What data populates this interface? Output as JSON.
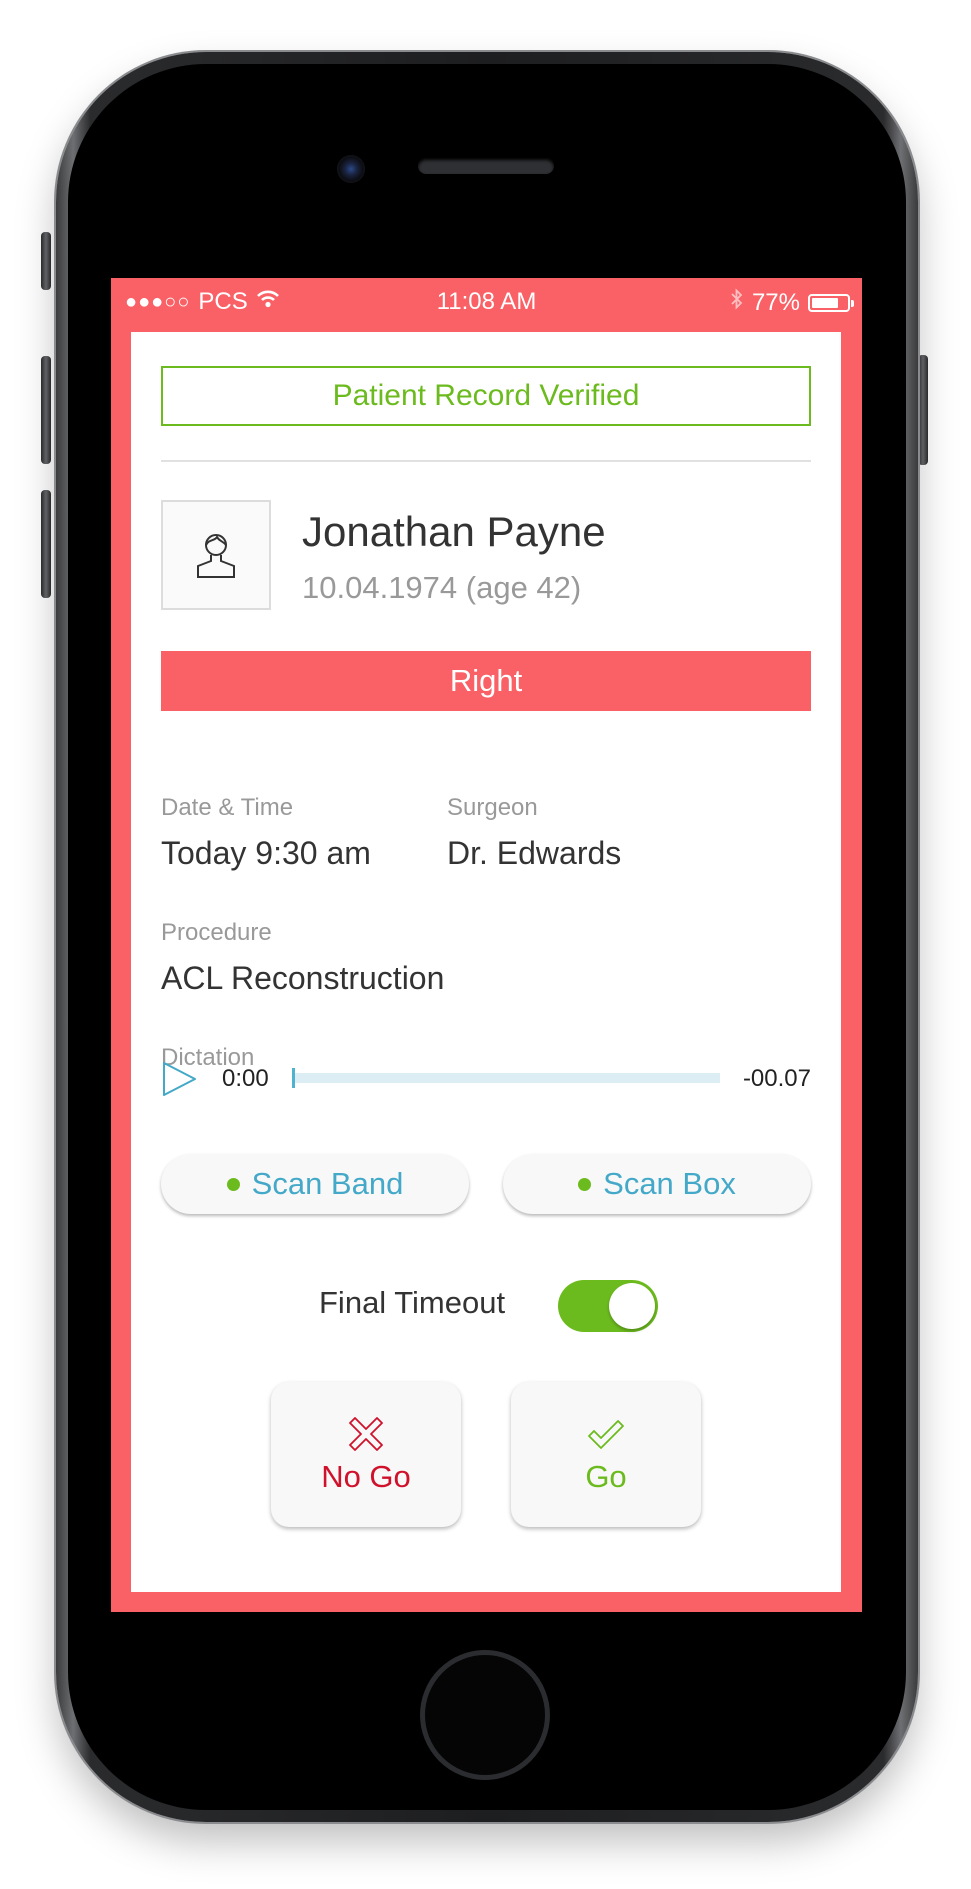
{
  "status_bar": {
    "signal": "●●●○○",
    "carrier": "PCS",
    "time": "11:08 AM",
    "battery": "77%",
    "battery_level": 0.77
  },
  "verification": {
    "label": "Patient Record Verified"
  },
  "patient": {
    "name": "Jonathan Payne",
    "dob": "10.04.1974 (age 42)"
  },
  "side_banner": {
    "label": "Right"
  },
  "details": {
    "date_label": "Date & Time",
    "date_value": "Today 9:30 am",
    "surgeon_label": "Surgeon",
    "surgeon_value": "Dr. Edwards",
    "procedure_label": "Procedure",
    "procedure_value": "ACL Reconstruction"
  },
  "dictation": {
    "label": "Dictation",
    "elapsed": "0:00",
    "remaining": "-00.07",
    "progress": 0
  },
  "scan_buttons": {
    "band": "Scan Band",
    "box": "Scan Box"
  },
  "final_timeout": {
    "label": "Final Timeout",
    "on": true
  },
  "decision": {
    "no_go": "No Go",
    "go": "Go"
  },
  "colors": {
    "brand_red": "#f96166",
    "success_green": "#6cbb1e",
    "link_blue": "#44a9c8",
    "danger_red": "#d0112b"
  }
}
